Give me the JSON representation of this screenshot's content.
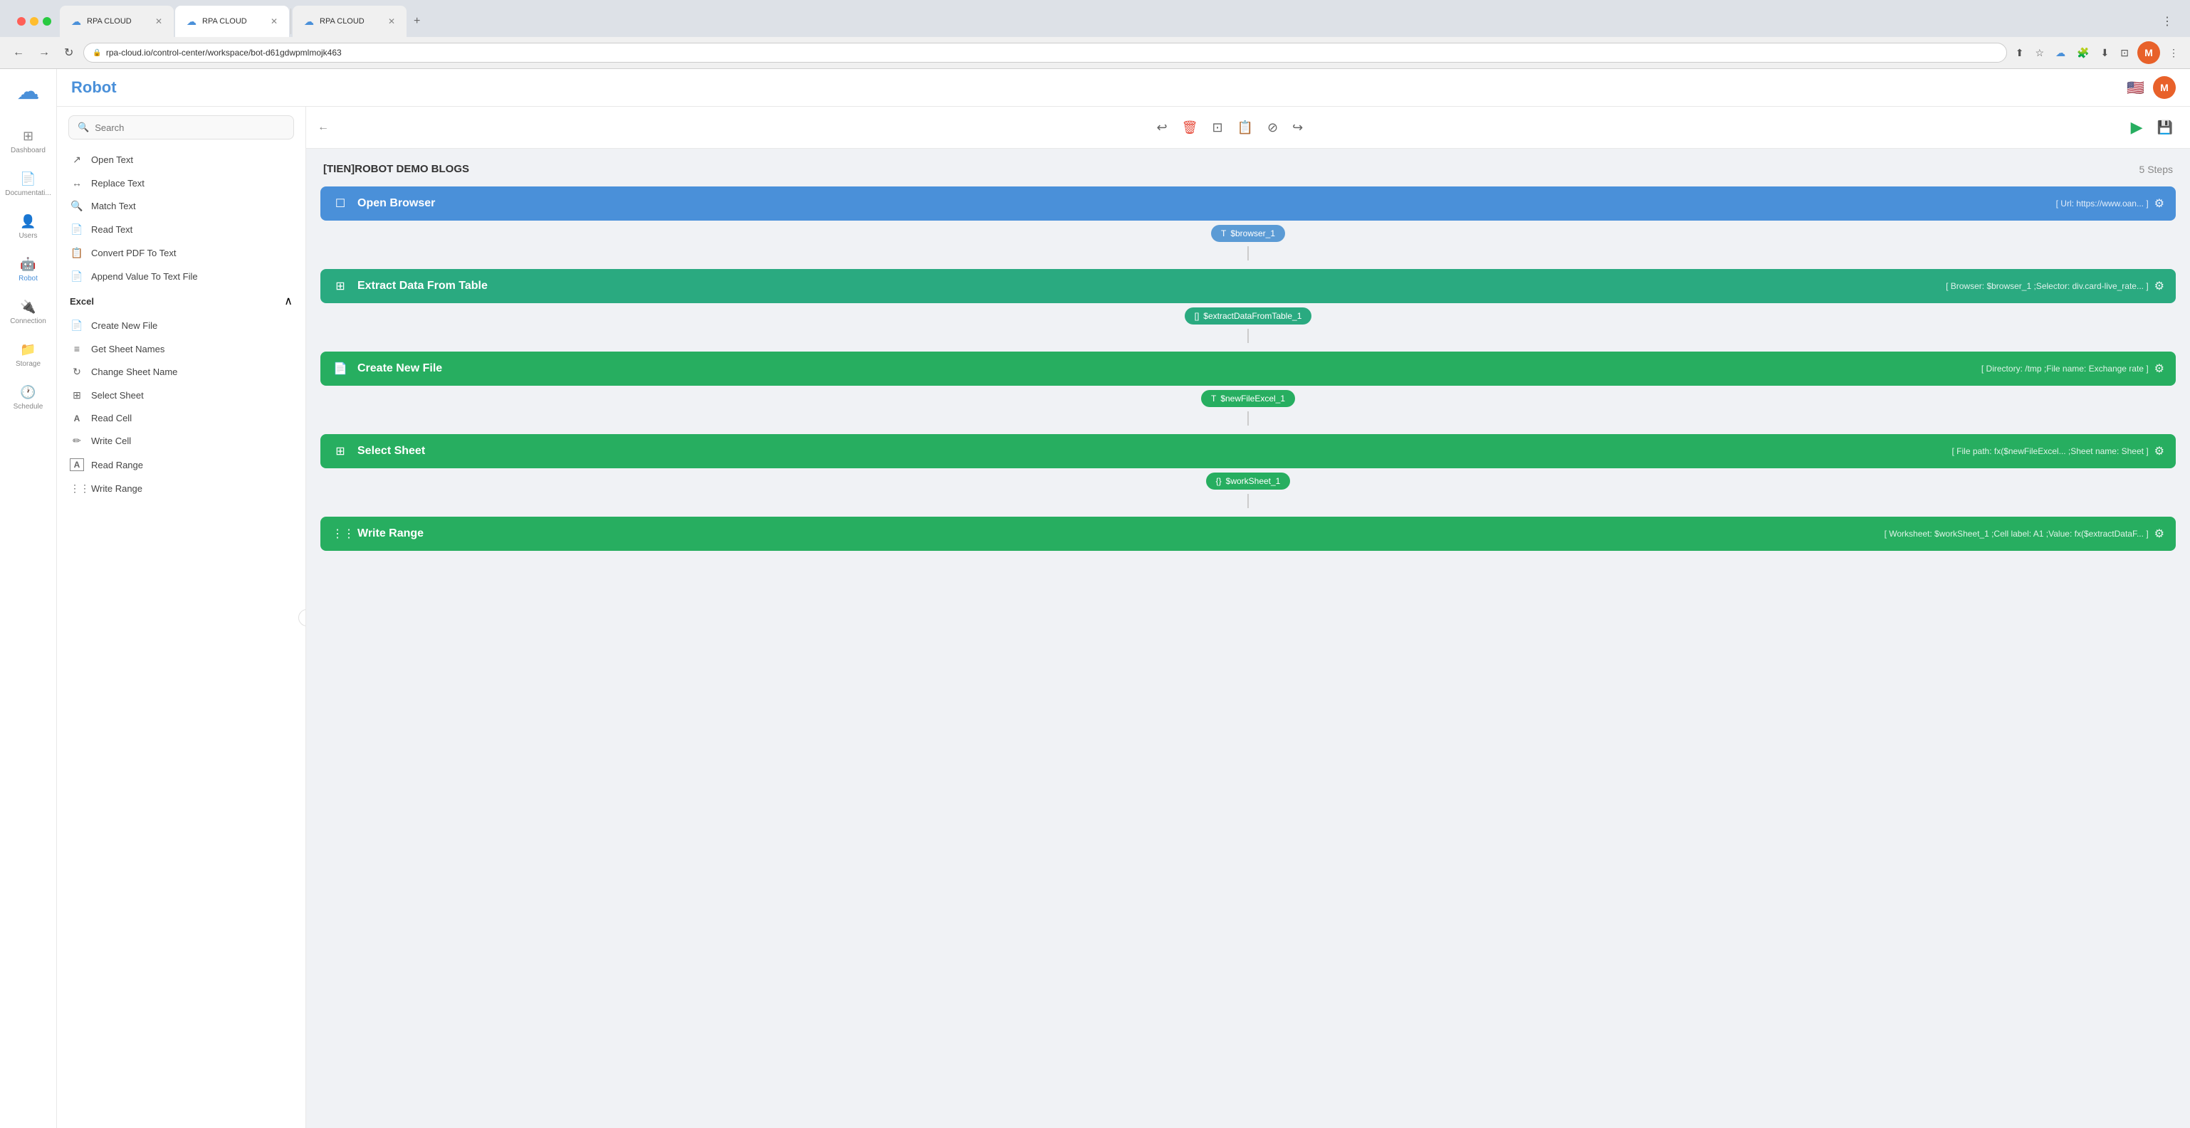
{
  "browser": {
    "tabs": [
      {
        "id": 1,
        "title": "RPA CLOUD",
        "active": false,
        "icon": "☁"
      },
      {
        "id": 2,
        "title": "RPA CLOUD",
        "active": true,
        "icon": "☁"
      },
      {
        "id": 3,
        "title": "RPA CLOUD",
        "active": false,
        "icon": "☁"
      }
    ],
    "url": "rpa-cloud.io/control-center/workspace/bot-d61gdwpmlmojk463",
    "url_prefix": "https://"
  },
  "app": {
    "title": "Robot",
    "logo_icon": "☁"
  },
  "sidebar_nav": {
    "items": [
      {
        "id": "dashboard",
        "label": "Dashboard",
        "icon": "⊞",
        "active": false
      },
      {
        "id": "documentation",
        "label": "Documentati...",
        "icon": "📄",
        "active": false
      },
      {
        "id": "users",
        "label": "Users",
        "icon": "👤",
        "active": false
      },
      {
        "id": "robot",
        "label": "Robot",
        "icon": "🤖",
        "active": true
      },
      {
        "id": "connection",
        "label": "Connection",
        "icon": "🔌",
        "active": false
      },
      {
        "id": "storage",
        "label": "Storage",
        "icon": "📁",
        "active": false
      },
      {
        "id": "schedule",
        "label": "Schedule",
        "icon": "🕐",
        "active": false
      }
    ]
  },
  "left_panel": {
    "search_placeholder": "Search",
    "items_above": [
      {
        "id": "open-text",
        "label": "Open Text",
        "icon": "↗"
      },
      {
        "id": "replace-text",
        "label": "Replace Text",
        "icon": "🔍"
      },
      {
        "id": "match-text",
        "label": "Match Text",
        "icon": "🔍"
      },
      {
        "id": "read-text",
        "label": "Read Text",
        "icon": "📄"
      },
      {
        "id": "convert-pdf",
        "label": "Convert PDF To Text",
        "icon": "📋"
      },
      {
        "id": "append-value",
        "label": "Append Value To Text File",
        "icon": "📄"
      }
    ],
    "excel_section": {
      "title": "Excel",
      "items": [
        {
          "id": "create-new-file",
          "label": "Create New File",
          "icon": "📄"
        },
        {
          "id": "get-sheet-names",
          "label": "Get Sheet Names",
          "icon": "≡"
        },
        {
          "id": "change-sheet-name",
          "label": "Change Sheet Name",
          "icon": "↻"
        },
        {
          "id": "select-sheet",
          "label": "Select Sheet",
          "icon": "⊞"
        },
        {
          "id": "read-cell",
          "label": "Read Cell",
          "icon": "A"
        },
        {
          "id": "write-cell",
          "label": "Write Cell",
          "icon": "✏"
        },
        {
          "id": "read-range",
          "label": "Read Range",
          "icon": "A"
        },
        {
          "id": "write-range",
          "label": "Write Range",
          "icon": "⋮⋮"
        }
      ]
    }
  },
  "canvas": {
    "title": "[TIEN]ROBOT DEMO BLOGS",
    "steps_label": "5 Steps",
    "steps": [
      {
        "id": "open-browser",
        "title": "Open Browser",
        "icon": "☐",
        "color": "blue",
        "params": "[ Url: https://www.oan... ]",
        "output_label": "$browser_1",
        "output_prefix": "T",
        "output_color": "badge-blue"
      },
      {
        "id": "extract-data",
        "title": "Extract Data From Table",
        "icon": "⊞",
        "color": "teal",
        "params": "[ Browser: $browser_1 ;Selector: div.card-live_rate... ]",
        "output_label": "$extractDataFromTable_1",
        "output_prefix": "[]",
        "output_color": "badge-teal"
      },
      {
        "id": "create-new-file",
        "title": "Create New File",
        "icon": "📄",
        "color": "green",
        "params": "[ Directory: /tmp ;File name: Exchange rate ]",
        "output_label": "$newFileExcel_1",
        "output_prefix": "T",
        "output_color": "badge-green"
      },
      {
        "id": "select-sheet",
        "title": "Select Sheet",
        "icon": "⊞",
        "color": "green",
        "params": "[ File path: fx($newFileExcel... ;Sheet name: Sheet ]",
        "output_label": "$workSheet_1",
        "output_prefix": "{}",
        "output_color": "badge-green"
      },
      {
        "id": "write-range",
        "title": "Write Range",
        "icon": "⋮⋮",
        "color": "green",
        "params": "[ Worksheet: $workSheet_1 ;Cell label: A1 ;Value: fx($extractDataF... ]",
        "output_label": null
      }
    ]
  }
}
